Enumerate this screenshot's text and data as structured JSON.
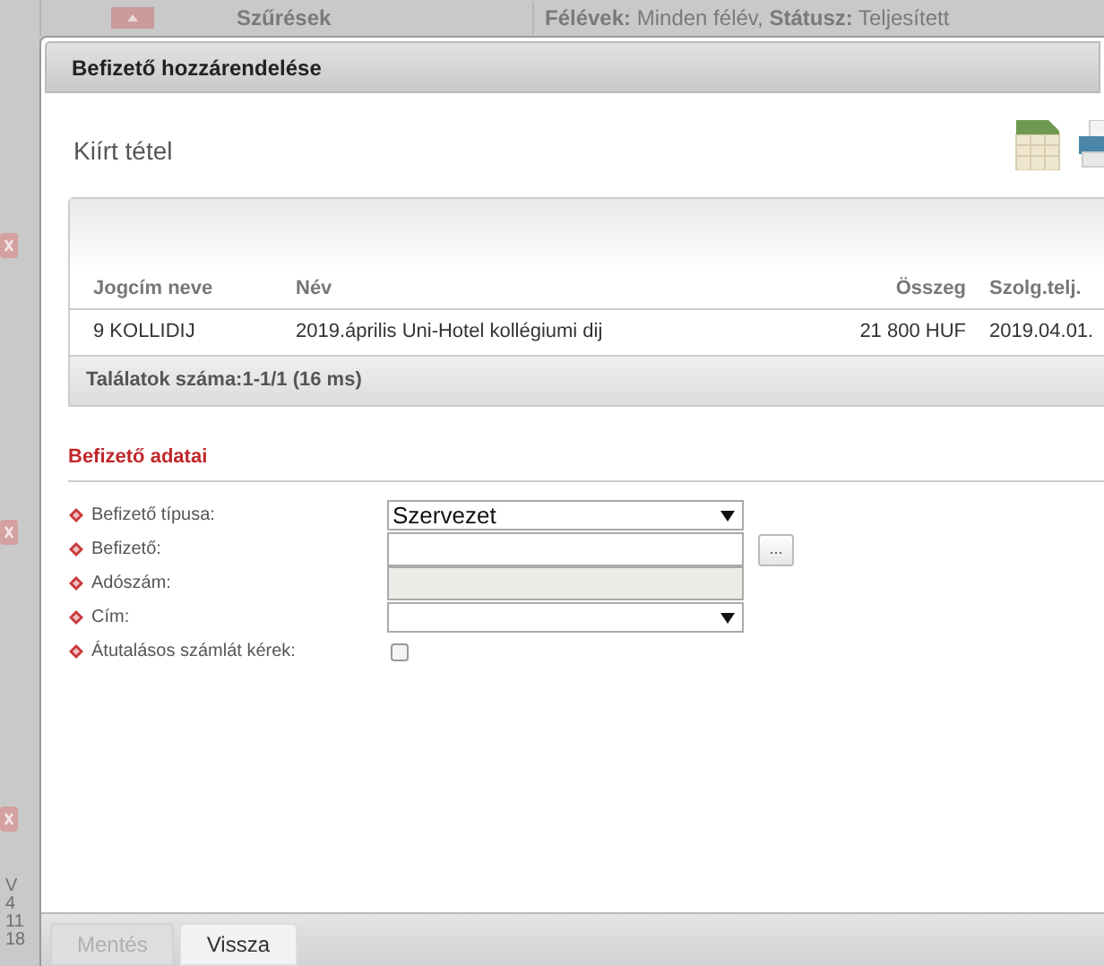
{
  "background": {
    "filter_label": "Szűrések",
    "filter_summary": "**Félévek:** Minden félév, **Státusz:** Teljesített",
    "calendar": [
      "V",
      "4",
      "11",
      "18"
    ]
  },
  "dialog": {
    "title": "Befizető hozzárendelése",
    "panel_title": "Kiírt tétel",
    "table": {
      "columns": [
        "Jogcím neve",
        "Név",
        "Összeg",
        "Szolg.telj."
      ],
      "rows": [
        {
          "cells": [
            "9 KOLLIDIJ",
            "2019.április Uni-Hotel kollégiumi dij",
            "21 800 HUF",
            "2019.04.01."
          ]
        }
      ],
      "footer": "Találatok száma:1-1/1 (16 ms)"
    },
    "form": {
      "title": "Befizető adatai",
      "fields": [
        {
          "label": "Befizető típusa:",
          "kind": "select",
          "value": "Szervezet"
        },
        {
          "label": "Befizető:",
          "kind": "lookup",
          "lookup_button": "..."
        },
        {
          "label": "Adószám:",
          "kind": "readonly"
        },
        {
          "label": "Cím:",
          "kind": "select"
        },
        {
          "label": "Átutalásos számlát kérek:",
          "kind": "checkbox",
          "checked": false
        }
      ]
    },
    "buttons": [
      {
        "label": "Mentés",
        "disabled": true
      },
      {
        "label": "Vissza",
        "disabled": false
      }
    ]
  }
}
